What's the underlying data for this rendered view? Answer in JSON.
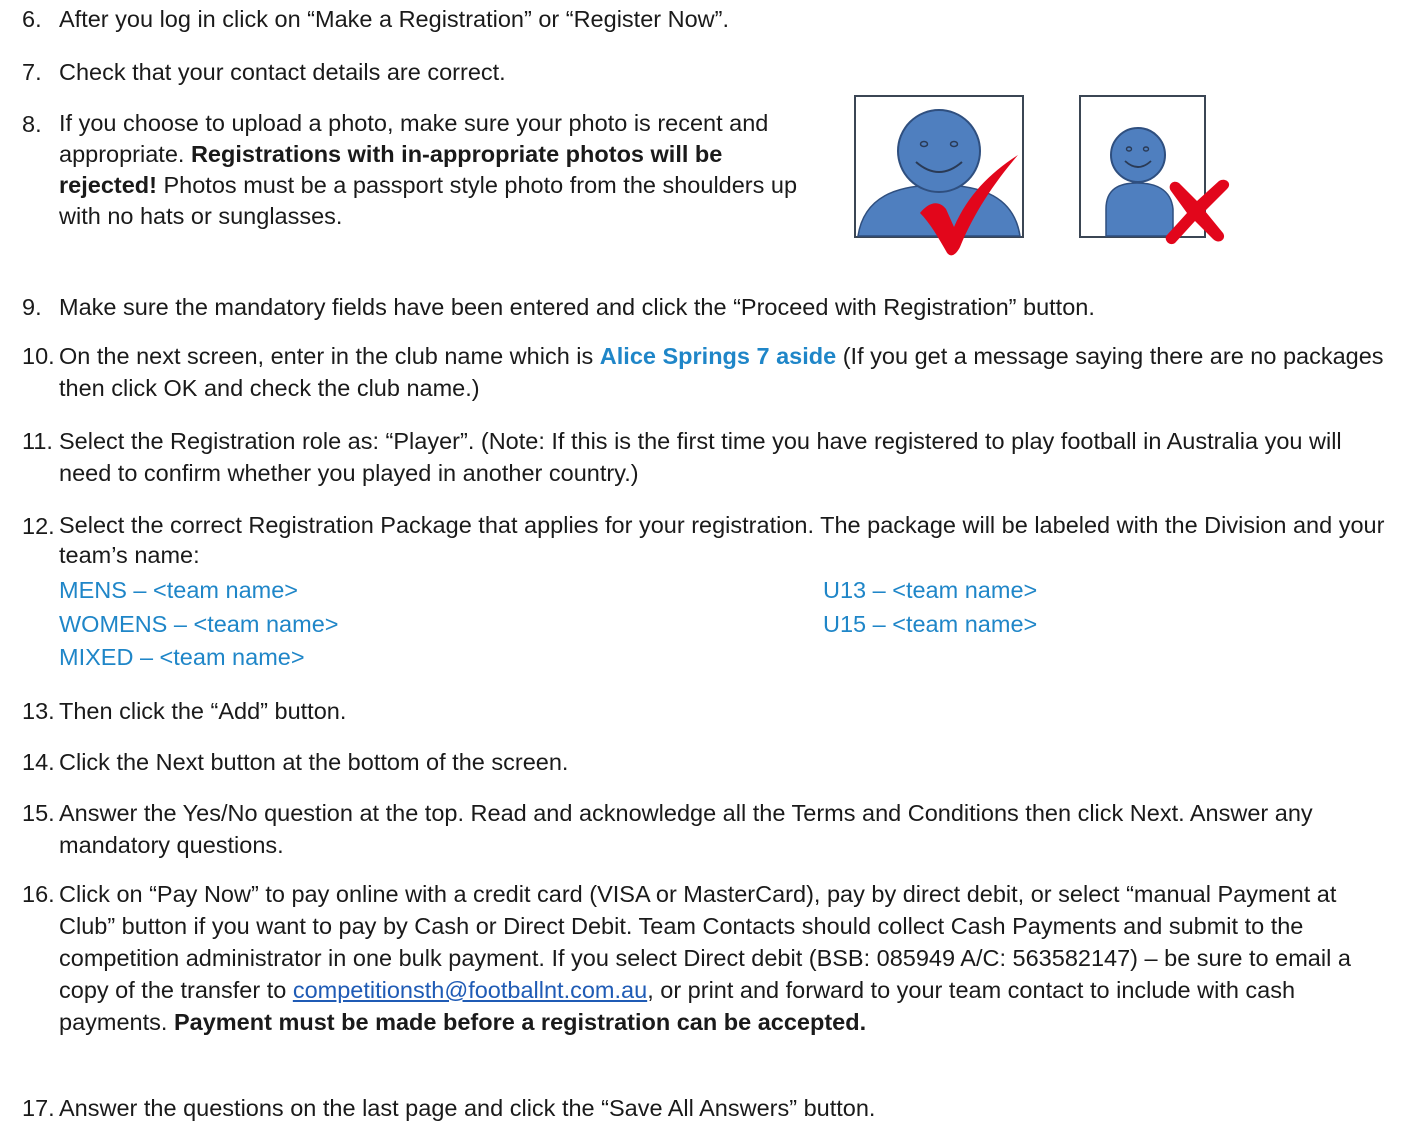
{
  "items": {
    "i6": {
      "num": "6.",
      "t1": "After you log in click on “Make a Registration” or “Register Now”."
    },
    "i7": {
      "num": "7.",
      "t1": "Check that your contact details are correct."
    },
    "i8": {
      "num": "8.",
      "t1": "If you choose to upload a photo, make sure your photo is recent and appropriate. ",
      "b1": "Registrations with in-appropriate photos will be rejected!",
      "t2": " Photos must be a passport style photo from the shoulders up with no hats or sunglasses."
    },
    "i9": {
      "num": "9.",
      "t1": "Make sure the mandatory fields have been entered and click the “Proceed with Registration” button."
    },
    "i10": {
      "num": "10.",
      "t1": "On the next screen, enter in the club name which is ",
      "b1": "Alice Springs 7 aside",
      "t2": " (If you get a message saying there are no packages then click OK and check the club name.)"
    },
    "i11": {
      "num": "11.",
      "t1": "Select the Registration role as: “Player”. (Note: If this is the first time you have registered to play football in Australia you will need to confirm whether you played in another country.)"
    },
    "i12": {
      "num": "12.",
      "t1": "Select the correct Registration Package that applies for your registration. The package will be labeled with the Division and your team’s name:"
    },
    "i13": {
      "num": "13.",
      "t1": "Then click the “Add” button."
    },
    "i14": {
      "num": "14.",
      "t1": "Click the Next button at the bottom of the screen."
    },
    "i15": {
      "num": "15.",
      "t1": "Answer the Yes/No question at the top. Read and acknowledge all the Terms and Conditions then click Next. Answer any mandatory questions."
    },
    "i16": {
      "num": "16.",
      "t1": "Click on “Pay Now” to pay online with a credit card (VISA or MasterCard), pay by direct debit, or select “manual Payment at Club” button if you want to pay by Cash or Direct Debit. Team Contacts should collect Cash Payments and submit to the competition administrator in one bulk payment. If you select Direct debit (BSB: 085949 A/C: 563582147) – be sure to email a copy of the transfer to ",
      "link": "competitionsth@footballnt.com.au",
      "t2": ", or print and forward to your team contact to include with cash payments. ",
      "b1": "Payment must be made before a registration can be accepted."
    },
    "i17": {
      "num": "17.",
      "t1": "Answer the questions on the last page and click the “Save All Answers” button."
    }
  },
  "packages": {
    "mens": "MENS – <team name>",
    "womens": "WOMENS – <team name>",
    "mixed": "MIXED – <team name>",
    "u13": "U13 – <team name>",
    "u15": "U15 – <team name>"
  },
  "colors": {
    "package_blue": "#1f86c8",
    "figure_blue": "#4f7fbf",
    "check_red": "#e2061b"
  },
  "icons": {
    "good": "check-mark-icon",
    "bad": "cross-mark-icon"
  }
}
